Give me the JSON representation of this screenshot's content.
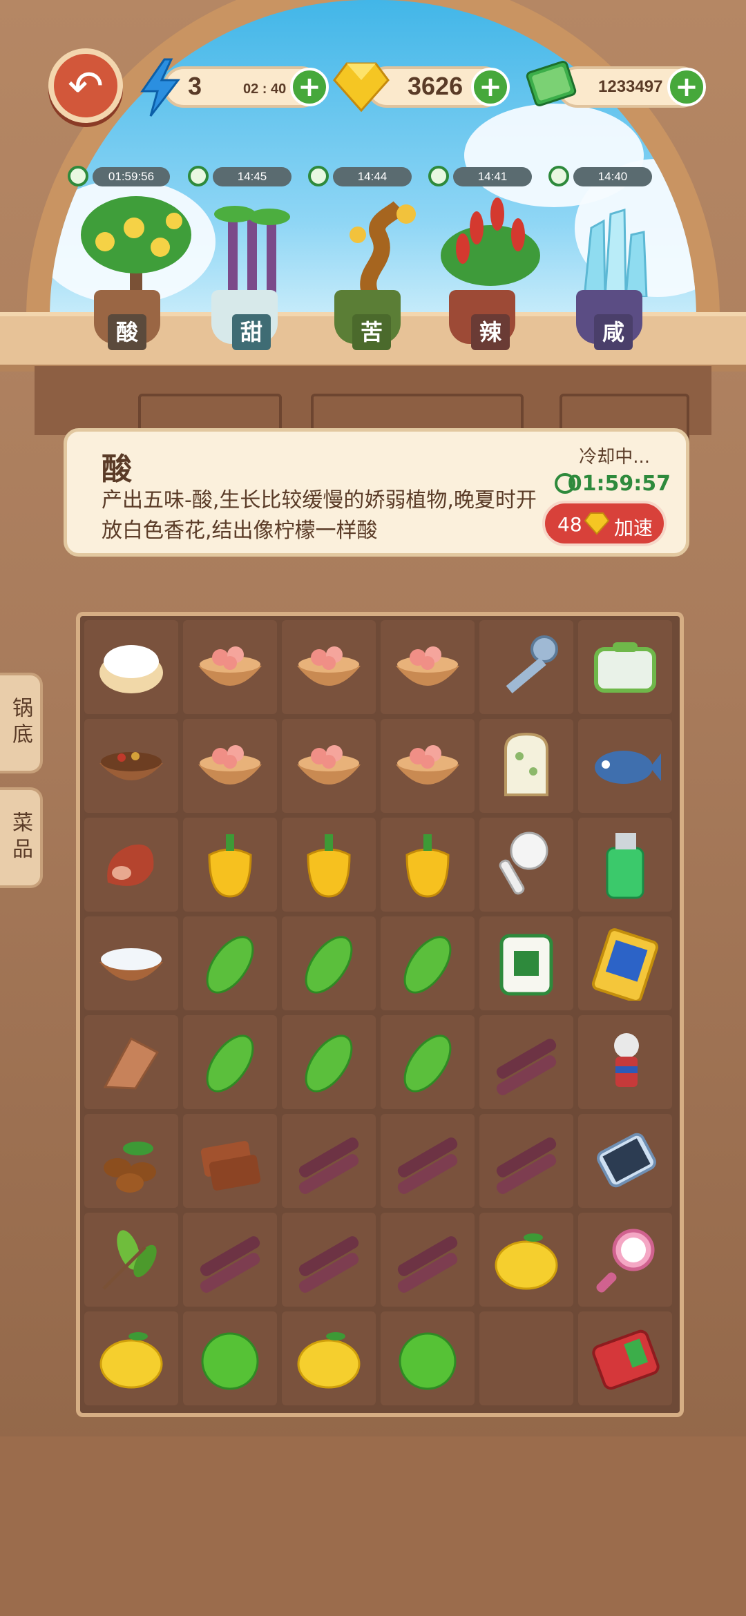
{
  "top_bar": {
    "energy": {
      "value": "3",
      "timer": "02 : 40",
      "icon": "lightning-icon"
    },
    "gems": {
      "value": "3626",
      "icon": "gem-icon"
    },
    "cash": {
      "value": "1233497",
      "icon": "cash-icon"
    }
  },
  "plants": [
    {
      "name": "酸",
      "timer": "01:59:56",
      "color": "#f3c94b"
    },
    {
      "name": "甜",
      "timer": "14:45",
      "color": "#7b4a8a"
    },
    {
      "name": "苦",
      "timer": "14:44",
      "color": "#c88a30"
    },
    {
      "name": "辣",
      "timer": "14:41",
      "color": "#d4392f"
    },
    {
      "name": "咸",
      "timer": "14:40",
      "color": "#8fdcf0"
    }
  ],
  "info": {
    "title": "酸",
    "description": "产出五味-酸,生长比较缓慢的娇弱植物,晚夏时开放白色香花,结出像柠檬一样酸",
    "cooldown_label": "冷却中...",
    "cooldown_time": "01:59:57",
    "speedup_cost": "48",
    "speedup_label": "加速"
  },
  "side_tabs": [
    "锅底",
    "菜品"
  ],
  "grid_items": [
    [
      "cream-puff",
      "shrimp-bowl",
      "shrimp-bowl",
      "shrimp-bowl",
      "key",
      "lunchbox"
    ],
    [
      "spice-bowl",
      "shrimp-bowl",
      "shrimp-bowl",
      "shrimp-bowl",
      "oven-mitt",
      "fish"
    ],
    [
      "ham",
      "bell-pepper",
      "bell-pepper",
      "bell-pepper",
      "earbud",
      "lighter"
    ],
    [
      "salt-bowl",
      "bitter-melon",
      "bitter-melon",
      "bitter-melon",
      "mahjong-tile",
      "trading-card"
    ],
    [
      "dried-fish",
      "bitter-melon",
      "bitter-melon",
      "bitter-melon",
      "sugarcane",
      "hero-toy"
    ],
    [
      "coffee-beans",
      "brown-sugar",
      "sugarcane",
      "sugarcane",
      "sugarcane",
      "smartphone"
    ],
    [
      "tea-leaves",
      "sugarcane",
      "sugarcane",
      "sugarcane",
      "lemon",
      "hand-mirror"
    ],
    [
      "lemon",
      "lime",
      "lemon",
      "lime",
      "",
      "wallet"
    ]
  ]
}
